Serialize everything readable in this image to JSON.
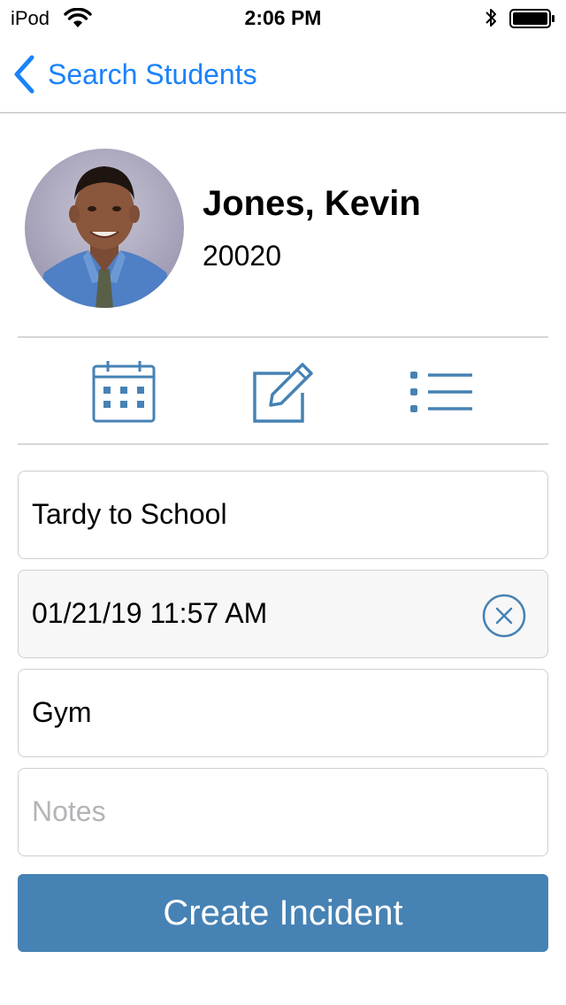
{
  "status_bar": {
    "carrier": "iPod",
    "time": "2:06 PM"
  },
  "nav": {
    "back_label": "Search Students"
  },
  "student": {
    "name": "Jones, Kevin",
    "id": "20020"
  },
  "actions": [
    {
      "icon": "calendar-icon"
    },
    {
      "icon": "edit-icon"
    },
    {
      "icon": "list-icon"
    }
  ],
  "form": {
    "incident_type": "Tardy to School",
    "date_time": "01/21/19 11:57 AM",
    "location": "Gym",
    "notes_placeholder": "Notes",
    "submit_label": "Create Incident"
  },
  "colors": {
    "accent": "#1a82fb",
    "icon": "#4682b4",
    "button": "#4682b4"
  }
}
